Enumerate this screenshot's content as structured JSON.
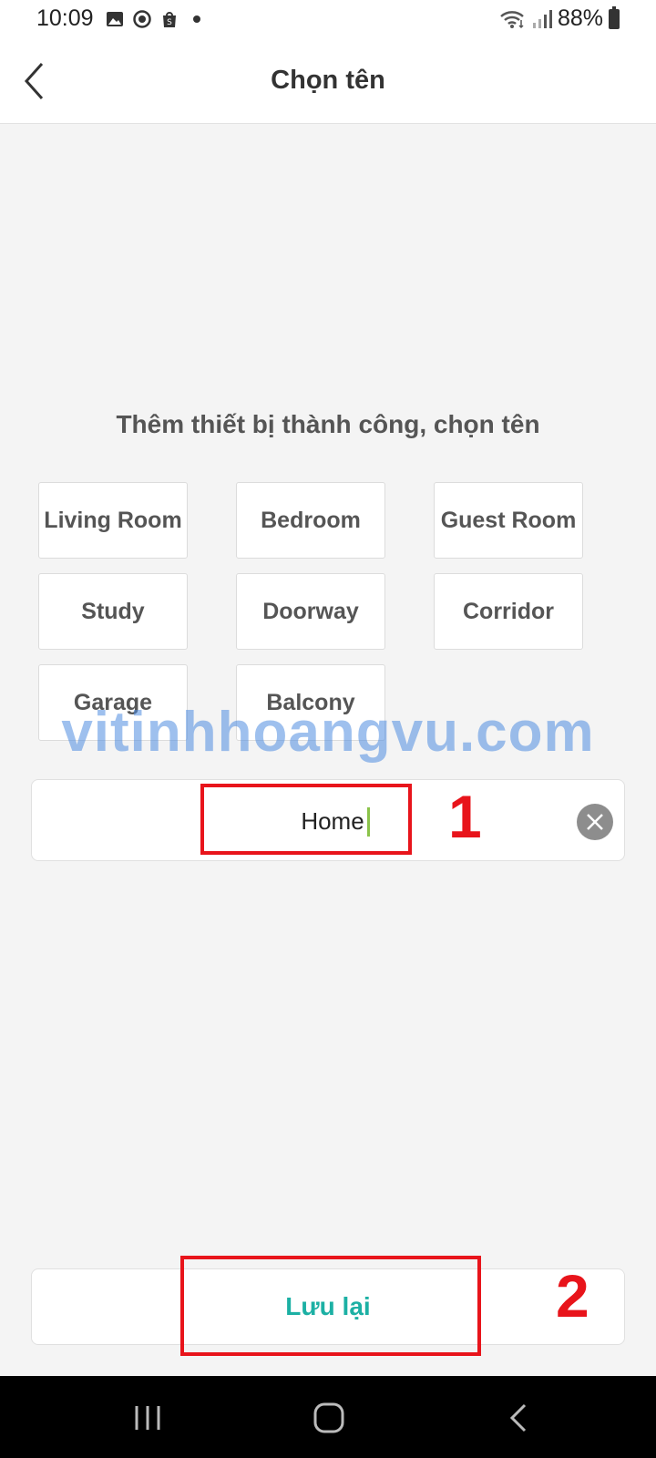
{
  "status_bar": {
    "time": "10:09",
    "battery": "88%",
    "icons": [
      "image-icon",
      "target-icon",
      "shop-icon",
      "dot-icon",
      "wifi-icon",
      "signal-icon",
      "battery-icon"
    ]
  },
  "header": {
    "title": "Chọn tên",
    "back_icon": "chevron-left-icon"
  },
  "main": {
    "subtitle": "Thêm thiết bị thành công, chọn tên",
    "suggestions": [
      "Living Room",
      "Bedroom",
      "Guest Room",
      "Study",
      "Doorway",
      "Corridor",
      "Garage",
      "Balcony"
    ],
    "name_field": {
      "value": "Home",
      "clear_icon": "clear-icon"
    },
    "save_label": "Lưu lại"
  },
  "overlay": {
    "watermark": "vitinhhoangvu.com",
    "step1": "1",
    "step2": "2"
  },
  "nav_bar": {
    "icons": [
      "recents-icon",
      "home-icon",
      "back-icon"
    ]
  },
  "colors": {
    "accent": "#1cb0a4",
    "annotation": "#e8141b",
    "watermark": "#4f8ce0",
    "background": "#f4f4f4"
  }
}
